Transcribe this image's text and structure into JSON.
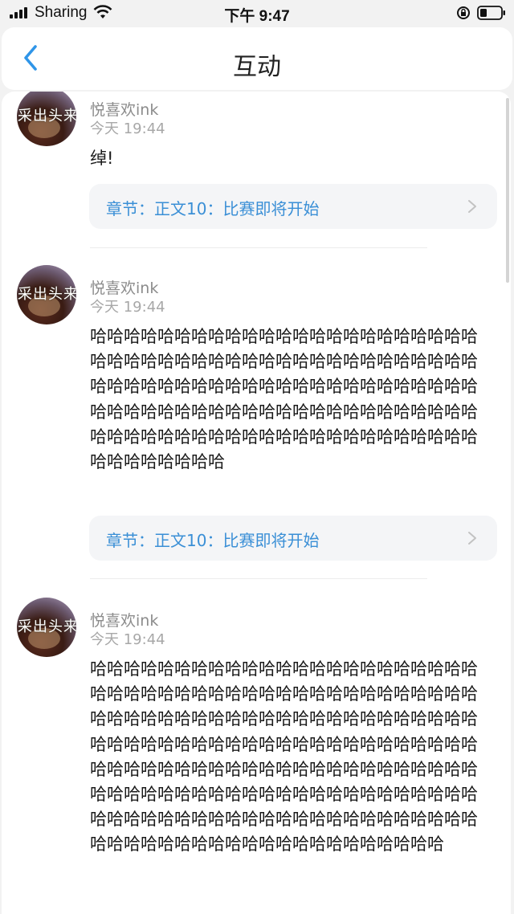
{
  "status_bar": {
    "carrier": "Sharing",
    "time": "下午 9:47",
    "icons": [
      "signal-icon",
      "wifi-icon",
      "rotation-lock-icon",
      "battery-icon"
    ]
  },
  "header": {
    "title": "互动",
    "back_icon": "chevron-left-icon"
  },
  "colors": {
    "accent": "#3a8fd6",
    "muted": "#8c8c8c",
    "background": "#f2f2f2"
  },
  "comments": [
    {
      "avatar_text": "采出头来",
      "username": "悦喜欢ink",
      "timestamp": "今天 19:44",
      "text": "绰!",
      "chapter": "章节：正文10：比赛即将开始"
    },
    {
      "avatar_text": "采出头来",
      "username": "悦喜欢ink",
      "timestamp": "今天 19:44",
      "text": "哈哈哈哈哈哈哈哈哈哈哈哈哈哈哈哈哈哈哈哈哈哈哈哈哈哈哈哈哈哈哈哈哈哈哈哈哈哈哈哈哈哈哈哈哈哈哈哈哈哈哈哈哈哈哈哈哈哈哈哈哈哈哈哈哈哈哈哈哈哈哈哈哈哈哈哈哈哈哈哈哈哈哈哈哈哈哈哈哈哈哈哈哈哈哈哈哈哈哈哈哈哈哈哈哈哈哈哈哈哈哈哈哈哈哈哈哈哈哈哈哈哈哈",
      "chapter": "章节：正文10：比赛即将开始"
    },
    {
      "avatar_text": "采出头来",
      "username": "悦喜欢ink",
      "timestamp": "今天 19:44",
      "text": "哈哈哈哈哈哈哈哈哈哈哈哈哈哈哈哈哈哈哈哈哈哈哈哈哈哈哈哈哈哈哈哈哈哈哈哈哈哈哈哈哈哈哈哈哈哈哈哈哈哈哈哈哈哈哈哈哈哈哈哈哈哈哈哈哈哈哈哈哈哈哈哈哈哈哈哈哈哈哈哈哈哈哈哈哈哈哈哈哈哈哈哈哈哈哈哈哈哈哈哈哈哈哈哈哈哈哈哈哈哈哈哈哈哈哈哈哈哈哈哈哈哈哈哈哈哈哈哈哈哈哈哈哈哈哈哈哈哈哈哈哈哈哈哈哈哈哈哈哈哈哈哈哈哈哈哈哈哈哈哈哈哈哈哈哈哈哈哈哈哈哈哈哈哈哈哈哈哈哈哈哈哈"
    }
  ]
}
